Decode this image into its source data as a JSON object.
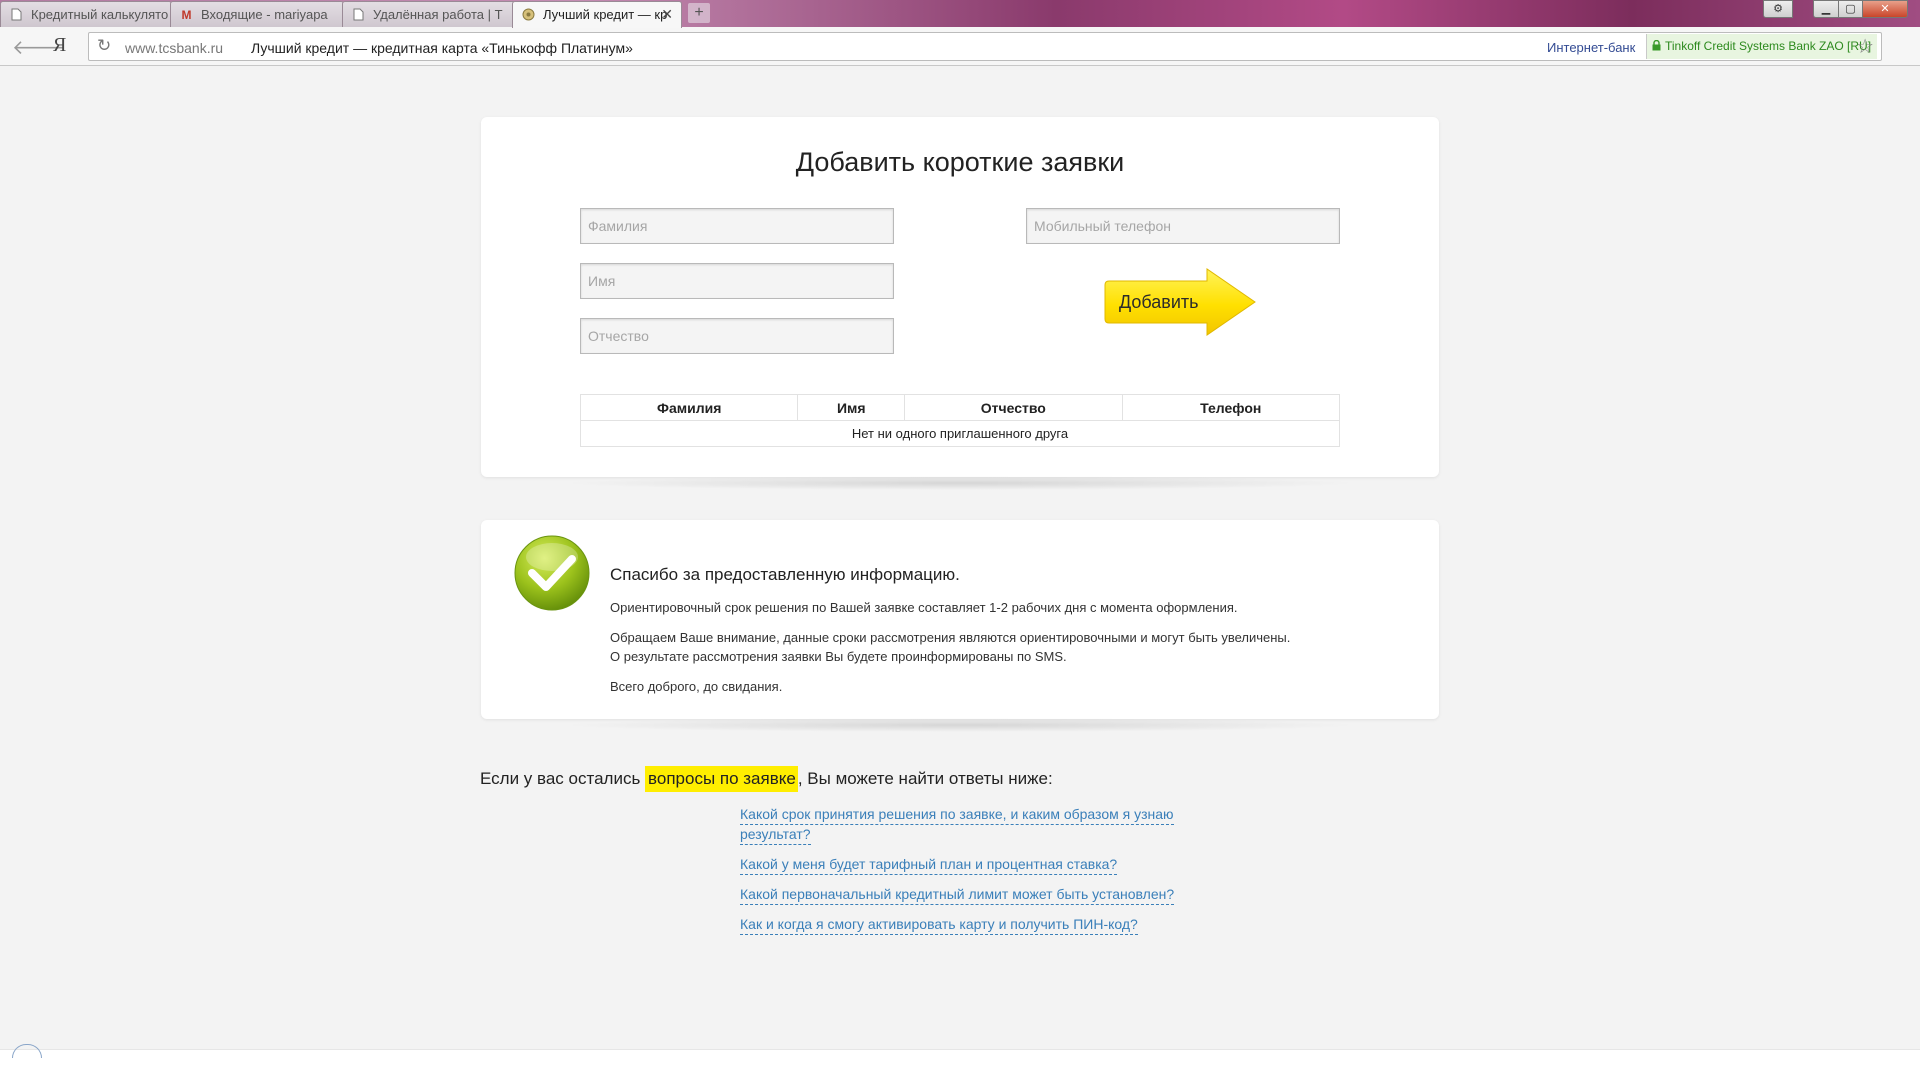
{
  "browser": {
    "tabs": [
      {
        "label": "Кредитный калькулято",
        "icon": "page-icon"
      },
      {
        "label": "Входящие - mariyapa",
        "icon": "gmail-icon"
      },
      {
        "label": "Удалённая работа | T",
        "icon": "page-icon"
      },
      {
        "label": "Лучший кредит — кр",
        "icon": "bank-icon",
        "active": true
      }
    ],
    "address": {
      "host": "www.tcsbank.ru",
      "title": "Лучший кредит — кредитная карта «Тинькофф Платинум»",
      "ibank_link": "Интернет-банк",
      "ev_cert": "Tinkoff Credit Systems Bank ZAO [RU]",
      "yandex_label": "Я"
    }
  },
  "form": {
    "title": "Добавить короткие заявки",
    "last_name_placeholder": "Фамилия",
    "first_name_placeholder": "Имя",
    "middle_name_placeholder": "Отчество",
    "phone_placeholder": "Мобильный телефон",
    "add_label": "Добавить",
    "table": {
      "headers": [
        "Фамилия",
        "Имя",
        "Отчество",
        "Телефон"
      ],
      "empty_message": "Нет ни одного приглашенного друга"
    }
  },
  "thanks": {
    "title": "Спасибо за предоставленную информацию.",
    "p1": "Ориентировочный срок решения по Вашей заявке составляет 1-2 рабочих дня с момента оформления.",
    "p2_line1": "Обращаем Ваше внимание, данные сроки рассмотрения являются ориентировочными и могут быть увеличены.",
    "p2_line2": "О результате рассмотрения заявки Вы будете проинформированы по SMS.",
    "p3": "Всего доброго, до свидания."
  },
  "faq": {
    "lead": "Если у вас остались ",
    "highlight": "вопросы по заявке",
    "tail": ", Вы можете найти ответы ниже:",
    "links": [
      "Какой срок принятия решения по заявке, и каким образом я узнаю",
      "результат?",
      "Какой у меня будет тарифный план и процентная ставка?",
      "Какой первоначальный кредитный лимит может быть установлен?",
      "Как и когда я смогу активировать карту и получить ПИН-код?"
    ]
  },
  "colors": {
    "accent_yellow": "#ffee00",
    "link_blue": "#3a7fb9",
    "check_green": "#8cb51b"
  }
}
